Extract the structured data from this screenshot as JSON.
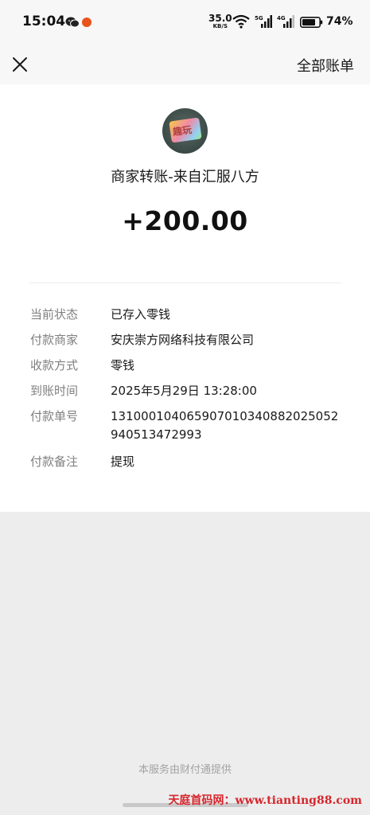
{
  "status_bar": {
    "time": "15:04",
    "net_speed": "35.0",
    "net_unit": "KB/S",
    "signal1_label": "5G",
    "signal2_label": "4G",
    "battery": "74%"
  },
  "nav": {
    "close_icon": "close-icon",
    "all_bills_label": "全部账单"
  },
  "transaction": {
    "merchant_title": "商家转账-来自汇服八方",
    "amount": "+200.00",
    "avatar_text": "趣玩"
  },
  "details": [
    {
      "label": "当前状态",
      "value": "已存入零钱"
    },
    {
      "label": "付款商家",
      "value": "安庆崇方网络科技有限公司"
    },
    {
      "label": "收款方式",
      "value": "零钱"
    },
    {
      "label": "到账时间",
      "value": "2025年5月29日 13:28:00"
    },
    {
      "label": "付款单号",
      "value": "131000104065907010340882025052940513472993"
    },
    {
      "label": "付款备注",
      "value": "提现"
    }
  ],
  "footer": {
    "provider_note": "本服务由财付通提供"
  },
  "watermark": "天庭首码网：www.tianting88.com",
  "colors": {
    "page_bg": "#ededed",
    "card_bg": "#ffffff",
    "label_gray": "#7f7f7f",
    "watermark_red": "#d6262d"
  }
}
